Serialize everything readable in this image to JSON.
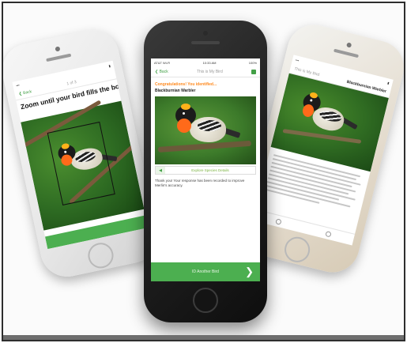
{
  "phones": {
    "left": {
      "back_label": "❮ Back",
      "step_label": "1 of 3",
      "instruction": "Zoom until your bird fills the box"
    },
    "center": {
      "carrier": "AT&T Wi-Fi",
      "time": "10:33 AM",
      "battery": "100%",
      "back_label": "❮ Back",
      "nav_title": "This is My Bird",
      "congrats": "Congratulations! You identified...",
      "species": "Blackburnian Warbler",
      "details_label": "Explore Species Details",
      "thank_you": "Thank you! Your response has been recorded to improve Merlin's accuracy.",
      "another_label": "ID Another Bird",
      "chevron": "❯"
    },
    "right": {
      "nav_title": "This is My Bird",
      "species_title": "Blackburnian Warbler"
    }
  },
  "colors": {
    "accent_green": "#4caf50",
    "accent_orange": "#ff8a1f"
  },
  "icons": {
    "play": "◀"
  }
}
